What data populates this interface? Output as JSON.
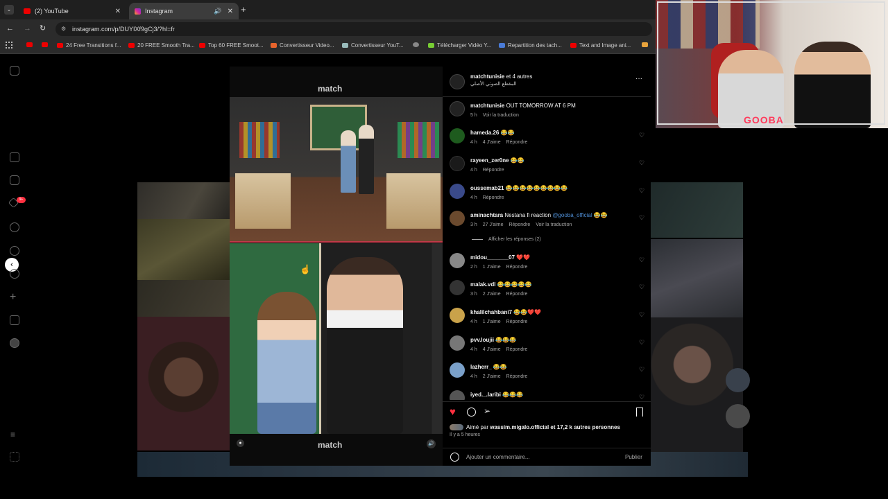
{
  "browser": {
    "tabs": [
      {
        "label": "(2) YouTube",
        "active": false
      },
      {
        "label": "Instagram",
        "active": true
      }
    ],
    "url": "instagram.com/p/DUYIXf9gCj3/?hl=fr",
    "bookmarks": [
      "24 Free Transitions f...",
      "20 FREE Smooth Tra...",
      "Top 60 FREE Smoot...",
      "Convertisseur Video...",
      "Convertisseur YouT...",
      "Télécharger Vidéo Y...",
      "Repartition des tach...",
      "Text and Image ani..."
    ]
  },
  "rail": {
    "notification_badge": "9+"
  },
  "post": {
    "watermark_top": "match",
    "watermark_bottom": "match",
    "header": {
      "author": "matchtunisie",
      "coauthors": "et 4 autres",
      "audio": "المقطع الصوتي الأصلي"
    },
    "caption": {
      "user": "matchtunisie",
      "text": "OUT TOMORROW AT 6 PM",
      "time": "5 h",
      "translate": "Voir la traduction"
    },
    "comments": [
      {
        "user": "hameda.26",
        "text": "😂😂",
        "time": "4 h",
        "likes": "4 J'aime",
        "reply": "Répondre",
        "color": "#1e5b1e"
      },
      {
        "user": "rayeen_zer0ne",
        "text": "😂😂",
        "time": "4 h",
        "likes": "",
        "reply": "Répondre",
        "color": "#222"
      },
      {
        "user": "oussemab21",
        "text": "😂😂😂😂😂😂😂😂😂",
        "time": "4 h",
        "likes": "",
        "reply": "Répondre",
        "color": "#3a4a8a"
      },
      {
        "user": "aminachtara",
        "text": "Nestana fi reaction",
        "mention": "@gooba_official",
        "text2": "😂😂",
        "time": "3 h",
        "likes": "27 J'aime",
        "reply": "Répondre",
        "translate": "Voir la traduction",
        "color": "#6b4a2e"
      },
      {
        "user": "midou_______07",
        "text": "❤️❤️",
        "time": "2 h",
        "likes": "1 J'aime",
        "reply": "Répondre",
        "color": "#888"
      },
      {
        "user": "malak.vdl",
        "text": "😂😂😂😂😂",
        "time": "3 h",
        "likes": "2 J'aime",
        "reply": "Répondre",
        "color": "#333"
      },
      {
        "user": "khalilchahbani7",
        "text": "😂😂❤️❤️",
        "time": "4 h",
        "likes": "1 J'aime",
        "reply": "Répondre",
        "color": "#c9a24a"
      },
      {
        "user": "pvv.loujii",
        "text": "😂😂😂",
        "time": "4 h",
        "likes": "4 J'aime",
        "reply": "Répondre",
        "color": "#777"
      },
      {
        "user": "lazherr_",
        "text": "😂😂",
        "time": "4 h",
        "likes": "2 J'aime",
        "reply": "Répondre",
        "color": "#7aa0c9"
      },
      {
        "user": "iyed._.laribi",
        "text": "😂😂😂",
        "time": "",
        "likes": "",
        "reply": "",
        "color": "#555"
      }
    ],
    "show_replies": "Afficher les réponses (2)",
    "liked_by": "Aimé par",
    "liked_user": "wassim.migalo.official",
    "liked_rest": "et 17,2 k autres personnes",
    "posted": "Il y a 5 heures",
    "comment_placeholder": "Ajouter un commentaire...",
    "publish": "Publier"
  },
  "webcam": {
    "label": "GOOBA"
  }
}
